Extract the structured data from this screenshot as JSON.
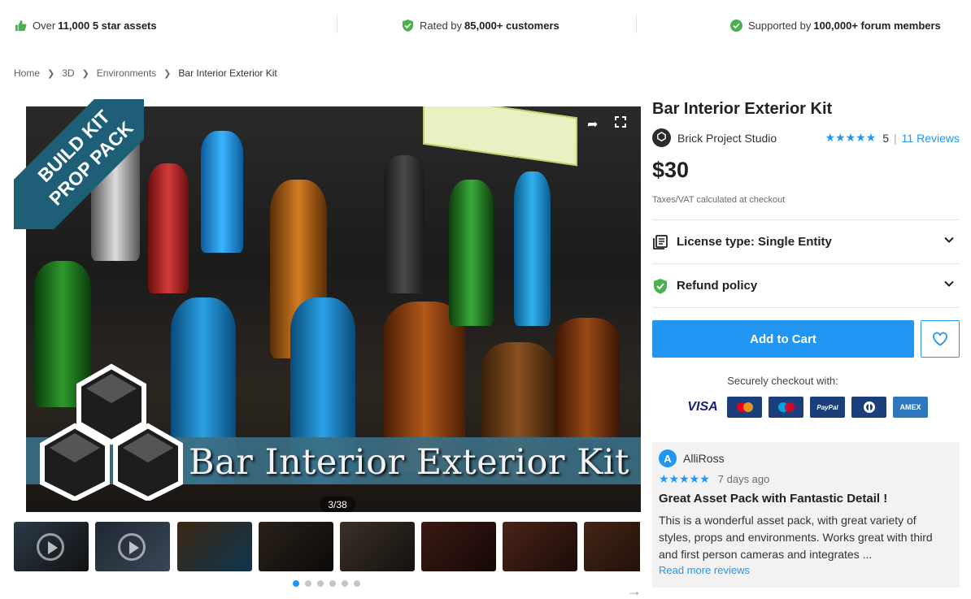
{
  "trust_bar": {
    "item1": {
      "prefix": "Over",
      "bold": "11,000 5 star assets",
      "suffix": ""
    },
    "item2": {
      "prefix": "Rated by",
      "bold": "85,000+ customers",
      "suffix": ""
    },
    "item3": {
      "prefix": "Supported by",
      "bold": "100,000+ forum members",
      "suffix": ""
    },
    "accent_color": "#4caf50"
  },
  "breadcrumb": [
    "Home",
    "3D",
    "Environments",
    "Bar Interior Exterior Kit"
  ],
  "hero": {
    "ribbon_line1": "BUILD KIT",
    "ribbon_line2": "PROP PACK",
    "overlay_title": "Bar Interior Exterior Kit",
    "counter": "3/38",
    "icons": [
      "share-icon",
      "fullscreen-icon"
    ]
  },
  "thumbnails": {
    "count": 9,
    "dots": 6,
    "active_dot": 0
  },
  "product": {
    "title": "Bar Interior Exterior Kit",
    "publisher": "Brick Project Studio",
    "rating_stars": "★★★★★",
    "rating_score": "5",
    "reviews_link": "11 Reviews",
    "price": "$30",
    "tax_note": "Taxes/VAT calculated at checkout",
    "license_label": "License type: Single Entity",
    "refund_label": "Refund policy",
    "add_to_cart": "Add to Cart",
    "secure_checkout": "Securely checkout with:",
    "payment_methods": [
      "VISA",
      "Mastercard",
      "Maestro",
      "PayPal",
      "Diners Club",
      "AMEX"
    ],
    "brand_color": "#2196f3"
  },
  "review": {
    "avatar_letter": "A",
    "author": "AlliRoss",
    "stars": "★★★★★",
    "time": "7 days ago",
    "title": "Great Asset Pack with Fantastic Detail !",
    "body": "This is a wonderful asset pack, with great variety of styles, props and environments.  Works great with third and first person cameras and integrates ...",
    "read_more": "Read more reviews"
  }
}
